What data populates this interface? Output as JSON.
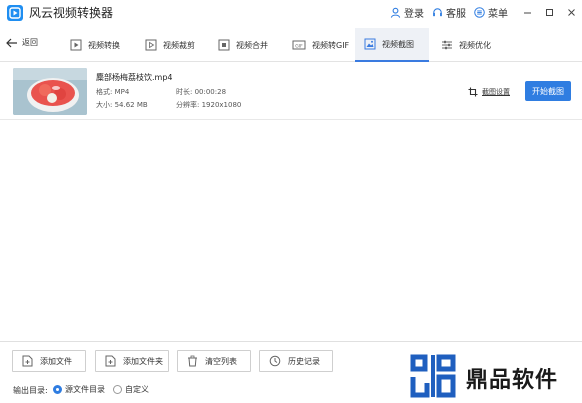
{
  "app": {
    "title": "风云视频转换器",
    "accent_color": "#2f7de1",
    "login_label": "登录",
    "service_label": "客服",
    "menu_label": "菜单"
  },
  "toolbar": {
    "back_label": "返回",
    "tools": [
      {
        "label": "视频转换",
        "icon": "convert-icon"
      },
      {
        "label": "视频裁剪",
        "icon": "cut-icon"
      },
      {
        "label": "视频合并",
        "icon": "merge-icon"
      },
      {
        "label": "视频转GIF",
        "icon": "gif-icon"
      },
      {
        "label": "视频截图",
        "icon": "screenshot-icon",
        "active": true
      },
      {
        "label": "视频优化",
        "icon": "optimize-icon"
      }
    ]
  },
  "file": {
    "name": "麋部杨梅荔枝饮.mp4",
    "format_label": "格式: MP4",
    "duration_label": "时长: 00:00:28",
    "size_label": "大小: 54.62 MB",
    "resolution_label": "分辨率: 1920x1080",
    "crop_settings_label": "截图设置",
    "start_button_label": "开始截图"
  },
  "bottom": {
    "add_file_label": "添加文件",
    "add_folder_label": "添加文件夹",
    "clear_list_label": "清空列表",
    "history_label": "历史记录",
    "output_dir_label": "输出目录:",
    "source_dir_label": "源文件目录",
    "custom_label": "自定义"
  },
  "watermark": {
    "text": "鼎品软件"
  }
}
